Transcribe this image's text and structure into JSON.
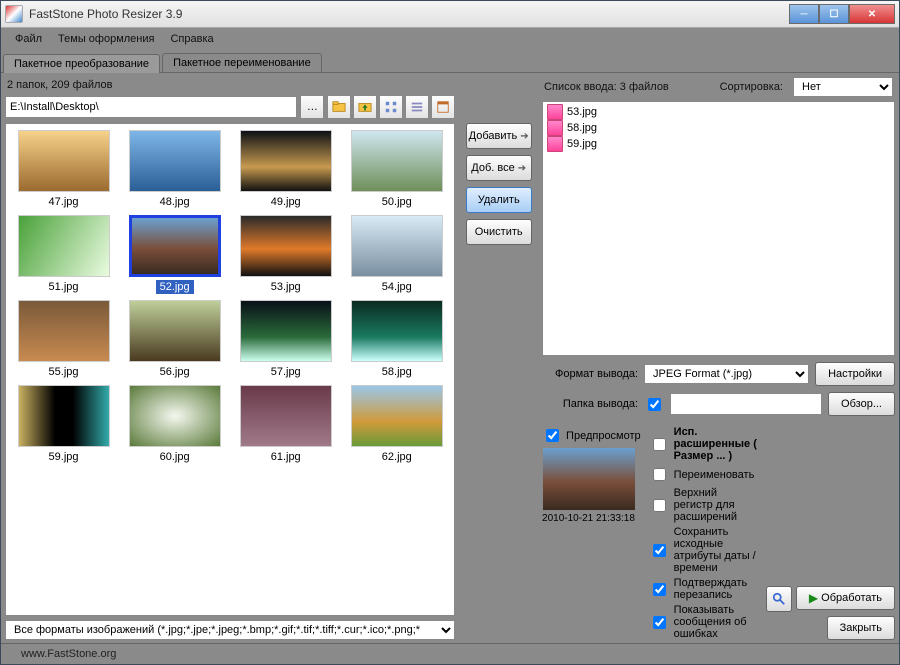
{
  "window": {
    "title": "FastStone Photo Resizer 3.9"
  },
  "menu": {
    "file": "Файл",
    "themes": "Темы оформления",
    "help": "Справка"
  },
  "tabs": {
    "batch_convert": "Пакетное преобразование",
    "batch_rename": "Пакетное переименование"
  },
  "left": {
    "folder_count": "2 папок, 209 файлов",
    "path": "E:\\Install\\Desktop\\",
    "filter": "Все форматы изображений (*.jpg;*.jpe;*.jpeg;*.bmp;*.gif;*.tif;*.tiff;*.cur;*.ico;*.png;*"
  },
  "thumbs": [
    {
      "name": "47.jpg",
      "sel": false
    },
    {
      "name": "48.jpg",
      "sel": false
    },
    {
      "name": "49.jpg",
      "sel": false
    },
    {
      "name": "50.jpg",
      "sel": false
    },
    {
      "name": "51.jpg",
      "sel": false
    },
    {
      "name": "52.jpg",
      "sel": true
    },
    {
      "name": "53.jpg",
      "sel": false
    },
    {
      "name": "54.jpg",
      "sel": false
    },
    {
      "name": "55.jpg",
      "sel": false
    },
    {
      "name": "56.jpg",
      "sel": false
    },
    {
      "name": "57.jpg",
      "sel": false
    },
    {
      "name": "58.jpg",
      "sel": false
    },
    {
      "name": "59.jpg",
      "sel": false
    },
    {
      "name": "60.jpg",
      "sel": false
    },
    {
      "name": "61.jpg",
      "sel": false
    },
    {
      "name": "62.jpg",
      "sel": false
    }
  ],
  "thumb_colors": [
    "linear-gradient(#f6d28a,#9b6a2f)",
    "linear-gradient(#7fb6e8,#2a5f96)",
    "linear-gradient(#0d1016,#c79a4f 60%,#111)",
    "linear-gradient(#cfe6ef,#6f8f5a)",
    "linear-gradient(120deg,#4aa13a,#eafbe0)",
    "linear-gradient(#6aa0d0,#7a4e3a 55%,#3a2a20)",
    "linear-gradient(#2a2a2a,#e07a2a 55%,#111)",
    "linear-gradient(#d8eaf5,#7a8fa0)",
    "linear-gradient(#7a5a3a,#c88a50)",
    "linear-gradient(#bfcf9a,#4a3a20)",
    "linear-gradient(#081018,#2a6a3a 60%,#cfe)",
    "linear-gradient(#0a2a20,#1a7a60 60%,#cff)",
    "linear-gradient(90deg,#c8b060,#000 40%,#000 60%,#3aa)",
    "radial-gradient(#f5f8ef,#5a7a3a)",
    "linear-gradient(#6a3a4a,#a07a8a)",
    "linear-gradient(#9ac6e8,#d09a3a 60%,#6a9a3a)"
  ],
  "mid": {
    "add": "Добавить",
    "add_all": "Доб. все",
    "remove": "Удалить",
    "clear": "Очистить"
  },
  "right": {
    "input_label": "Список ввода:  3 файлов",
    "sort_label": "Сортировка:",
    "sort_value": "Нет",
    "files": [
      "53.jpg",
      "58.jpg",
      "59.jpg"
    ],
    "format_label": "Формат вывода:",
    "format_value": "JPEG Format (*.jpg)",
    "settings_btn": "Настройки",
    "folder_label": "Папка вывода:",
    "folder_value": "",
    "browse_btn": "Обзор..."
  },
  "preview": {
    "label": "Предпросмотр",
    "timestamp": "2010-10-21 21:33:18"
  },
  "options": {
    "use_advanced": "Исп. расширенные ( Размер ... )",
    "rename": "Переименовать",
    "upper_ext": "Верхний регистр для расширений",
    "keep_date": "Сохранить исходные атрибуты даты / времени",
    "confirm_overwrite": "Подтверждать перезапись",
    "show_errors": "Показывать сообщения об ошибках"
  },
  "actions": {
    "process": "Обработать",
    "close": "Закрыть"
  },
  "status": {
    "url": "www.FastStone.org"
  }
}
